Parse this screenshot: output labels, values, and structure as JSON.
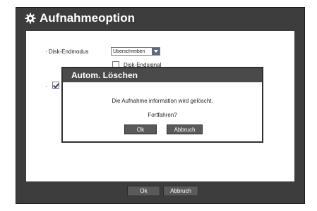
{
  "window": {
    "title": "Aufnahmeoption"
  },
  "disk_end_mode": {
    "label": "Disk-Endmodus",
    "selected": "Überschreiben",
    "signal_label": "Disk-Endsignal"
  },
  "footer": {
    "ok_label": "Ok",
    "cancel_label": "Abbruch"
  },
  "dialog": {
    "title": "Autom. Löschen",
    "message": "Die Aufnahme information wird gelöscht.",
    "question": "Fortfahren?",
    "ok_label": "Ok",
    "cancel_label": "Abbruch"
  },
  "colors": {
    "frame": "#3d3d3d",
    "dialog_title": "#4a4a4a",
    "button": "#5a5a5a",
    "select_arrow": "#5f6a78"
  },
  "icons": {
    "title": "gear-icon",
    "select": "chevron-down-icon"
  }
}
